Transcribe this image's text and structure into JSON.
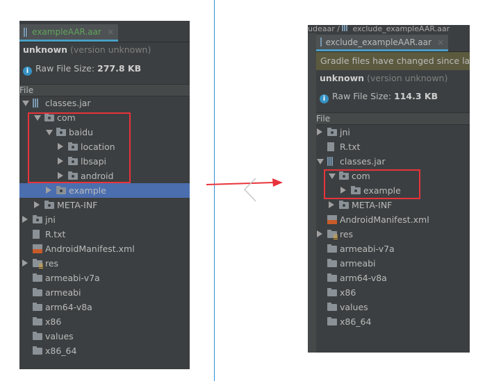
{
  "left": {
    "tab_title": "exampleAAR.aar",
    "name": "unknown",
    "version": "(version unknown)",
    "size_label": "Raw File Size:",
    "size_value": "277.8 KB",
    "column_header": "File",
    "tree": [
      {
        "label": "classes.jar",
        "level": 0,
        "arrow": "down",
        "icon": "jar"
      },
      {
        "label": "com",
        "level": 1,
        "arrow": "down",
        "icon": "package"
      },
      {
        "label": "baidu",
        "level": 2,
        "arrow": "down",
        "icon": "package"
      },
      {
        "label": "location",
        "level": 3,
        "arrow": "right",
        "icon": "package"
      },
      {
        "label": "lbsapi",
        "level": 3,
        "arrow": "right",
        "icon": "package"
      },
      {
        "label": "android",
        "level": 3,
        "arrow": "right",
        "icon": "package"
      },
      {
        "label": "example",
        "level": 2,
        "arrow": "right",
        "icon": "package",
        "selected": true
      },
      {
        "label": "META-INF",
        "level": 1,
        "arrow": "right",
        "icon": "package"
      },
      {
        "label": "jni",
        "level": 0,
        "arrow": "right",
        "icon": "package"
      },
      {
        "label": "R.txt",
        "level": 0,
        "icon": "text-file"
      },
      {
        "label": "AndroidManifest.xml",
        "level": 0,
        "icon": "xml-file"
      },
      {
        "label": "res",
        "level": 0,
        "arrow": "right",
        "icon": "resource-folder"
      },
      {
        "label": "armeabi-v7a",
        "level": 0,
        "icon": "folder"
      },
      {
        "label": "armeabi",
        "level": 0,
        "icon": "folder"
      },
      {
        "label": "arm64-v8a",
        "level": 0,
        "icon": "folder"
      },
      {
        "label": "x86",
        "level": 0,
        "icon": "folder"
      },
      {
        "label": "values",
        "level": 0,
        "icon": "folder"
      },
      {
        "label": "x86_64",
        "level": 0,
        "icon": "folder"
      }
    ]
  },
  "right": {
    "breadcrumb_prev": "udeaar",
    "breadcrumb_current": "exclude_exampleAAR.aar",
    "tab_title": "exclude_exampleAAR.aar",
    "banner": "Gradle files have changed since last",
    "name": "unknown",
    "version": "(version unknown)",
    "size_label": "Raw File Size:",
    "size_value": "114.3 KB",
    "column_header": "File",
    "tree": [
      {
        "label": "jni",
        "level": 0,
        "arrow": "right",
        "icon": "package"
      },
      {
        "label": "R.txt",
        "level": 0,
        "icon": "text-file"
      },
      {
        "label": "classes.jar",
        "level": 0,
        "arrow": "down",
        "icon": "jar"
      },
      {
        "label": "com",
        "level": 1,
        "arrow": "down",
        "icon": "package"
      },
      {
        "label": "example",
        "level": 2,
        "arrow": "right",
        "icon": "package"
      },
      {
        "label": "META-INF",
        "level": 1,
        "arrow": "right",
        "icon": "package"
      },
      {
        "label": "AndroidManifest.xml",
        "level": 0,
        "icon": "xml-file"
      },
      {
        "label": "res",
        "level": 0,
        "arrow": "right",
        "icon": "resource-folder"
      },
      {
        "label": "armeabi-v7a",
        "level": 0,
        "icon": "folder"
      },
      {
        "label": "armeabi",
        "level": 0,
        "icon": "folder"
      },
      {
        "label": "arm64-v8a",
        "level": 0,
        "icon": "folder"
      },
      {
        "label": "x86",
        "level": 0,
        "icon": "folder"
      },
      {
        "label": "values",
        "level": 0,
        "icon": "folder"
      },
      {
        "label": "x86_64",
        "level": 0,
        "icon": "folder"
      }
    ]
  },
  "colors": {
    "highlight_box": "#e8333a",
    "selection": "#4b6eaf",
    "divider": "#2f8fd8",
    "banner": "#5b5a3e"
  }
}
